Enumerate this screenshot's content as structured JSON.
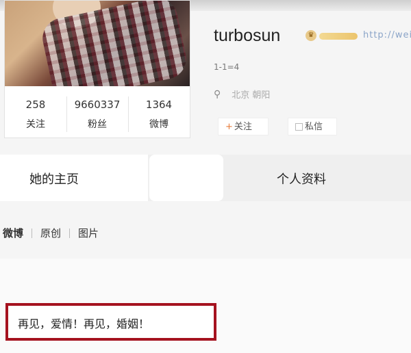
{
  "profile": {
    "username": "turbosun",
    "badge_icon": "crown-icon",
    "link_text": "http://wei",
    "bio": "1-1=4",
    "location": "北京 朝阳",
    "follow_label": "关注",
    "message_label": "私信",
    "stats": [
      {
        "value": "258",
        "label": "关注"
      },
      {
        "value": "9660337",
        "label": "粉丝"
      },
      {
        "value": "1364",
        "label": "微博"
      }
    ]
  },
  "tabs": {
    "home": "她的主页",
    "profile": "个人资料"
  },
  "subtabs": [
    "微博",
    "原创",
    "图片"
  ],
  "post": {
    "text": "再见，爱情！再见，婚姻！"
  },
  "colors": {
    "highlight_border": "#a5121f",
    "follow_plus": "#e77b3a"
  }
}
